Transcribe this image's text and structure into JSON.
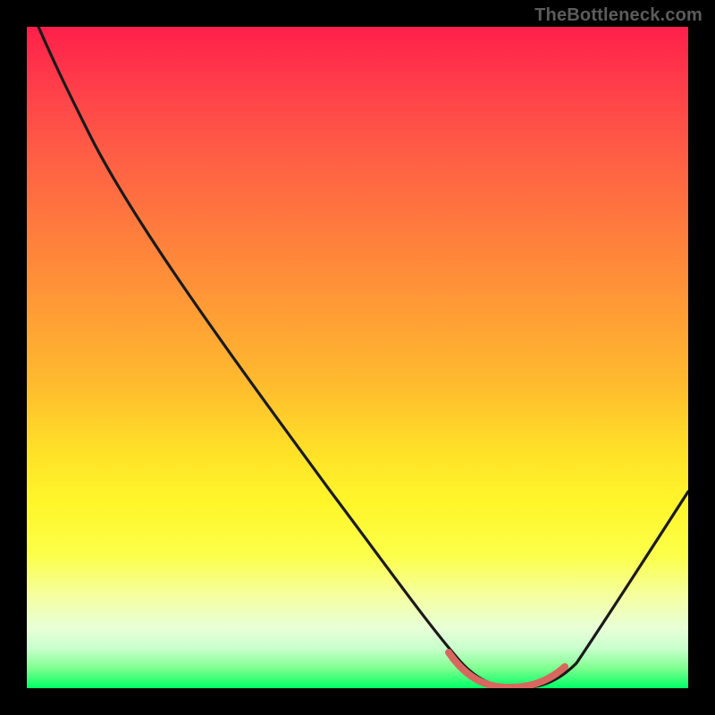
{
  "watermark": {
    "text": "TheBottleneck.com"
  },
  "colors": {
    "background": "#000000",
    "curve_stroke": "#1a1a1a",
    "highlight_stroke": "#d8675f",
    "gradient_top": "#ff1f4a",
    "gradient_bottom": "#00ff66"
  },
  "chart_data": {
    "type": "line",
    "title": "",
    "xlabel": "",
    "ylabel": "",
    "xlim": [
      0,
      100
    ],
    "ylim": [
      0,
      100
    ],
    "grid": false,
    "legend": null,
    "series": [
      {
        "name": "bottleneck-curve",
        "x": [
          0,
          4,
          8,
          15,
          25,
          35,
          45,
          55,
          63,
          67,
          70,
          73,
          76,
          80,
          84,
          90,
          95,
          100
        ],
        "values": [
          105,
          95,
          89,
          80,
          68,
          56,
          44,
          32,
          18,
          10,
          4,
          1,
          1,
          4,
          12,
          25,
          35,
          45
        ]
      }
    ],
    "highlight_range": {
      "x_start": 63,
      "x_end": 80
    },
    "notes": "Values estimated from pixel gradient; y=0 at bottom (green) rising to ~100 at top (red). Curve descends from upper-left, reaches a flat minimum near x≈70–78, then rises toward the right edge."
  }
}
